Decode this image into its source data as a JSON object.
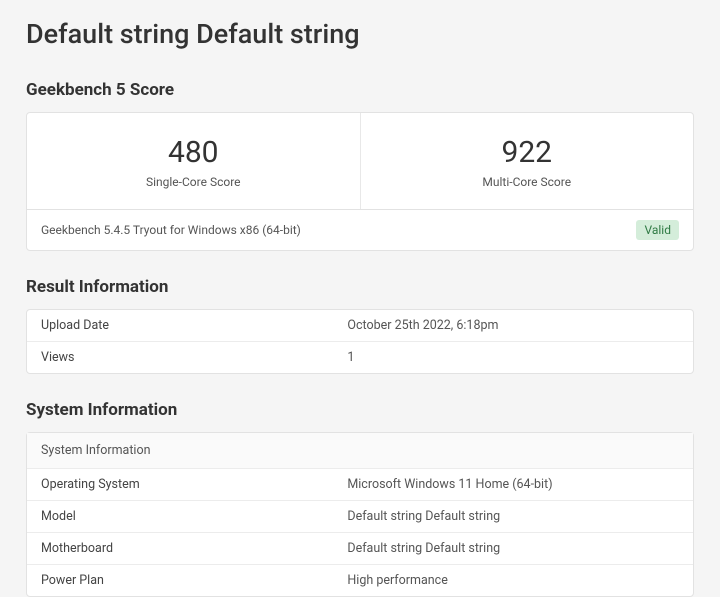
{
  "title": "Default string Default string",
  "score_section": {
    "heading": "Geekbench 5 Score",
    "single": {
      "value": "480",
      "label": "Single-Core Score"
    },
    "multi": {
      "value": "922",
      "label": "Multi-Core Score"
    },
    "version_line": "Geekbench 5.4.5 Tryout for Windows x86 (64-bit)",
    "status_badge": "Valid"
  },
  "result_info": {
    "heading": "Result Information",
    "rows": [
      {
        "key": "Upload Date",
        "value": "October 25th 2022, 6:18pm"
      },
      {
        "key": "Views",
        "value": "1"
      }
    ]
  },
  "system_info": {
    "heading": "System Information",
    "subheader": "System Information",
    "rows": [
      {
        "key": "Operating System",
        "value": "Microsoft Windows 11 Home (64-bit)"
      },
      {
        "key": "Model",
        "value": "Default string Default string"
      },
      {
        "key": "Motherboard",
        "value": "Default string Default string"
      },
      {
        "key": "Power Plan",
        "value": "High performance"
      }
    ]
  }
}
